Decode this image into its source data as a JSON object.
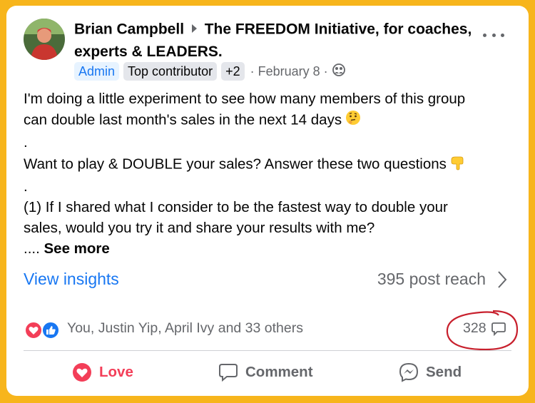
{
  "post": {
    "author": "Brian Campbell",
    "group": "The FREEDOM Initiative, for coaches, experts & LEADERS.",
    "badges": [
      "Admin",
      "Top contributor",
      "+2"
    ],
    "date": "· February 8 ·",
    "text_lines": [
      "I'm doing a little experiment to see how many members of this group",
      "can double last month's sales in the next 14 days",
      ".",
      "Want to play & DOUBLE your sales? Answer these two questions",
      ".",
      "(1) If I shared what I consider to be the fastest way to double your",
      "sales, would you try it and share your results with me?"
    ],
    "ellipsis": "....",
    "see_more": "See more"
  },
  "insights": {
    "link": "View insights",
    "reach": "395 post reach"
  },
  "reactions": {
    "summary": "You, Justin Yip, April Ivy and 33 others",
    "comment_count": "328"
  },
  "actions": {
    "love": "Love",
    "comment": "Comment",
    "send": "Send"
  },
  "colors": {
    "background": "#f7b51c",
    "link_blue": "#1877f2",
    "love_red": "#f33e58",
    "annotation_red": "#c8202d"
  }
}
